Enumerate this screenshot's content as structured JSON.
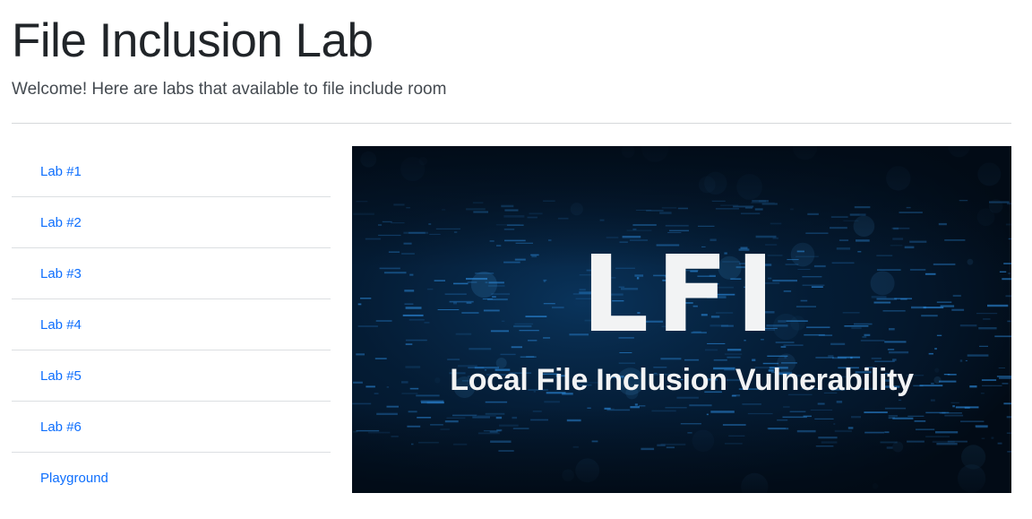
{
  "header": {
    "title": "File Inclusion Lab",
    "lead": "Welcome! Here are labs that available to file include room"
  },
  "labs": [
    {
      "label": "Lab #1"
    },
    {
      "label": "Lab #2"
    },
    {
      "label": "Lab #3"
    },
    {
      "label": "Lab #4"
    },
    {
      "label": "Lab #5"
    },
    {
      "label": "Lab #6"
    },
    {
      "label": "Playground"
    }
  ],
  "banner": {
    "title": "LFI",
    "subtitle": "Local File Inclusion Vulnerability"
  },
  "colors": {
    "link": "#0d6efd",
    "banner_bg": "#02101f",
    "banner_accent": "#1b6fb8"
  }
}
